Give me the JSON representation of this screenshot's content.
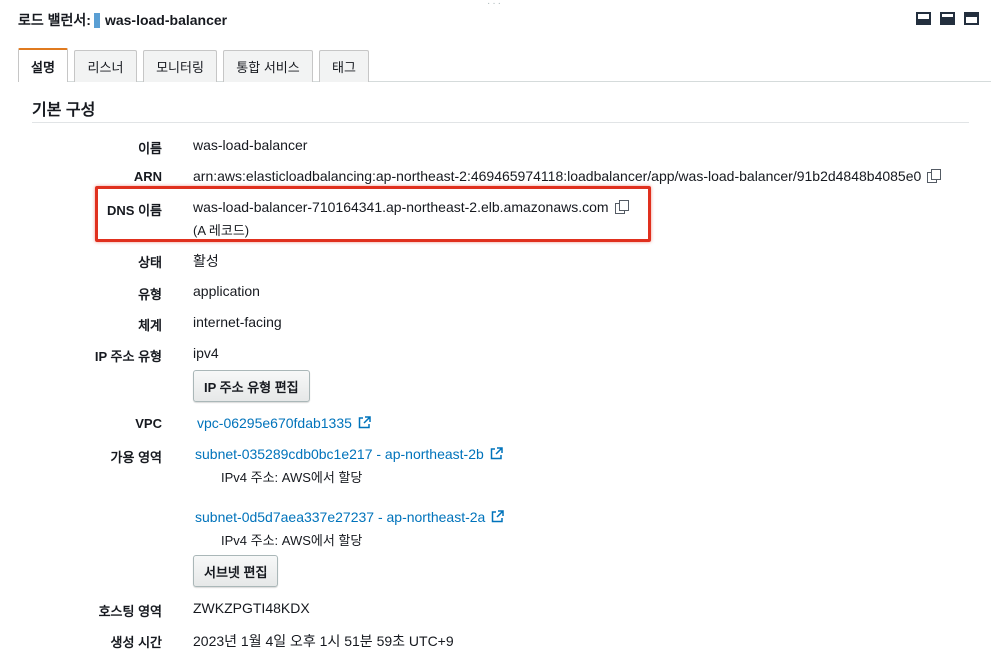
{
  "header": {
    "label": "로드 밸런서:",
    "name": "was-load-balancer"
  },
  "tabs": [
    {
      "label": "설명",
      "active": true
    },
    {
      "label": "리스너",
      "active": false
    },
    {
      "label": "모니터링",
      "active": false
    },
    {
      "label": "통합 서비스",
      "active": false
    },
    {
      "label": "태그",
      "active": false
    }
  ],
  "section": {
    "title": "기본 구성"
  },
  "details": {
    "name": {
      "label": "이름",
      "value": "was-load-balancer"
    },
    "arn": {
      "label": "ARN",
      "value": "arn:aws:elasticloadbalancing:ap-northeast-2:469465974118:loadbalancer/app/was-load-balancer/91b2d4848b4085e0"
    },
    "dns": {
      "label": "DNS 이름",
      "value": "was-load-balancer-710164341.ap-northeast-2.elb.amazonaws.com",
      "record": "(A 레코드)"
    },
    "state": {
      "label": "상태",
      "value": "활성"
    },
    "type": {
      "label": "유형",
      "value": "application"
    },
    "scheme": {
      "label": "체계",
      "value": "internet-facing"
    },
    "ip_type": {
      "label": "IP 주소 유형",
      "value": "ipv4",
      "edit_button": "IP 주소 유형 편집"
    },
    "vpc": {
      "label": "VPC",
      "value": "vpc-06295e670fdab1335"
    },
    "az": {
      "label": "가용 영역",
      "subnets": [
        {
          "name": "subnet-035289cdb0bc1e217 - ap-northeast-2b",
          "ipv4": "IPv4 주소: AWS에서 할당"
        },
        {
          "name": "subnet-0d5d7aea337e27237 - ap-northeast-2a",
          "ipv4": "IPv4 주소: AWS에서 할당"
        }
      ],
      "edit_button": "서브넷 편집"
    },
    "hosted_zone": {
      "label": "호스팅 영역",
      "value": "ZWKZPGTI48KDX"
    },
    "created": {
      "label": "생성 시간",
      "value": "2023년 1월 4일 오후 1시 51분 59초 UTC+9"
    }
  },
  "colors": {
    "link": "#0073bb",
    "highlight": "#e0301e",
    "active_tab_accent": "#e07a1f"
  }
}
